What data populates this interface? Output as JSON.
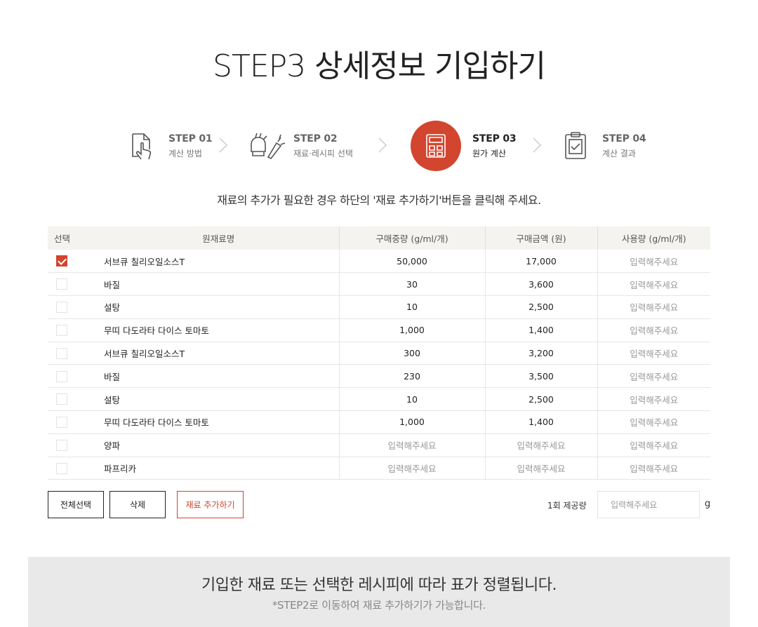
{
  "page_title": "STEP3 상세정보 기입하기",
  "steps": [
    {
      "num": "STEP 01",
      "label": "계산 방법",
      "icon": "hand-tap-icon"
    },
    {
      "num": "STEP 02",
      "label": "재료·레시피 선택",
      "icon": "vegetables-icon"
    },
    {
      "num": "STEP 03",
      "label": "원가 계산",
      "icon": "calculator-icon",
      "active": true
    },
    {
      "num": "STEP 04",
      "label": "계산 결과",
      "icon": "clipboard-check-icon"
    }
  ],
  "instruction": "재료의 추가가 필요한 경우 하단의 '재료 추가하기'버튼을 클릭해 주세요.",
  "table": {
    "headers": [
      "선택",
      "원재료명",
      "구매중량 (g/ml/개)",
      "구매금액 (원)",
      "사용량 (g/ml/개)"
    ],
    "placeholder": "입력해주세요",
    "rows": [
      {
        "checked": true,
        "name": "서브큐 칠리오일소스T",
        "weight": "50,000",
        "price": "17,000"
      },
      {
        "checked": false,
        "name": "바질",
        "weight": "30",
        "price": "3,600"
      },
      {
        "checked": false,
        "name": "설탕",
        "weight": "10",
        "price": "2,500"
      },
      {
        "checked": false,
        "name": "무띠 다도라타 다이스 토마토",
        "weight": "1,000",
        "price": "1,400"
      },
      {
        "checked": false,
        "name": "서브큐 칠리오일소스T",
        "weight": "300",
        "price": "3,200"
      },
      {
        "checked": false,
        "name": "바질",
        "weight": "230",
        "price": "3,500"
      },
      {
        "checked": false,
        "name": "설탕",
        "weight": "10",
        "price": "2,500"
      },
      {
        "checked": false,
        "name": "무띠 다도라타 다이스 토마토",
        "weight": "1,000",
        "price": "1,400"
      },
      {
        "checked": false,
        "name": "양파",
        "weight": "입력해주세요",
        "price": "입력해주세요"
      },
      {
        "checked": false,
        "name": "파프리카",
        "weight": "입력해주세요",
        "price": "입력해주세요"
      }
    ]
  },
  "buttons": {
    "select_all": "전체선택",
    "delete": "삭제",
    "add_ingredient": "재료 추가하기"
  },
  "serving": {
    "label": "1회 제공량",
    "placeholder": "입력해주세요",
    "unit": "g"
  },
  "footer": {
    "main": "기입한 재료 또는 선택한 레시피에 따라 표가 정렬됩니다.",
    "sub": "*STEP2로 이동하여 재료 추가하기가 가능합니다."
  },
  "colors": {
    "accent": "#d2452e",
    "header_bg": "#f5f3f0",
    "footer_bg": "#e9e9e9"
  }
}
